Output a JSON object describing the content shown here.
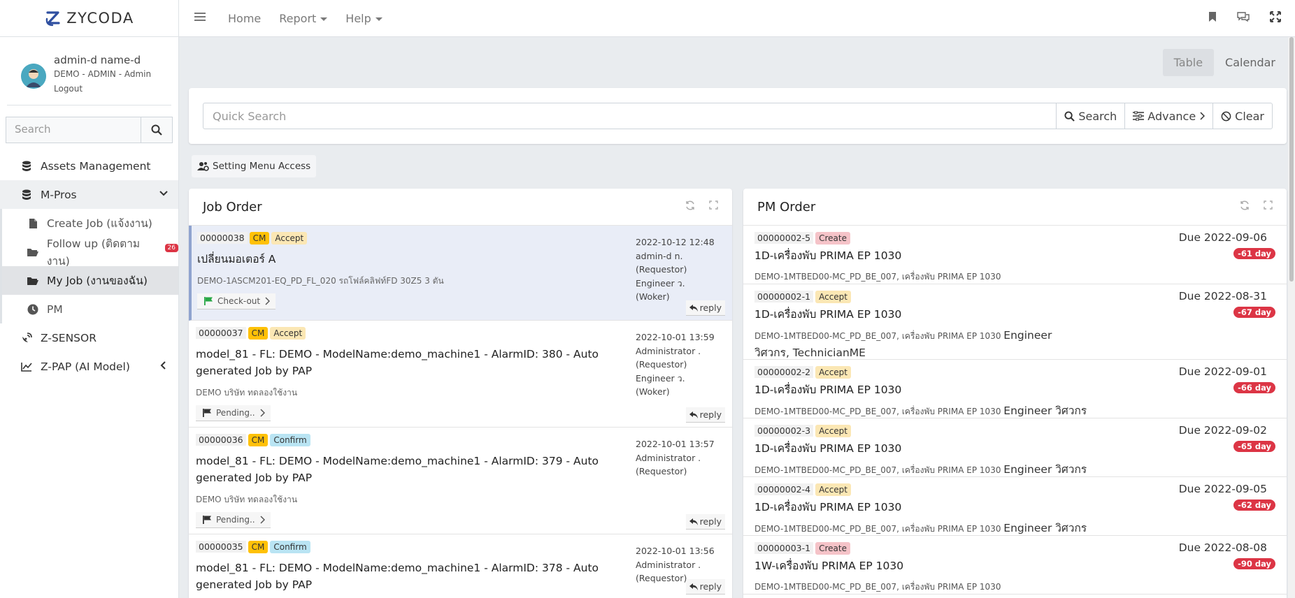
{
  "brand": {
    "name": "ZYCODA"
  },
  "user": {
    "name": "admin-d name-d",
    "role": "DEMO - ADMIN - Admin",
    "logout": "Logout"
  },
  "sidebar": {
    "search_placeholder": "Search",
    "items": [
      {
        "label": "Assets Management"
      },
      {
        "label": "M-Pros"
      },
      {
        "label": "Create Job (แจ้งงาน)"
      },
      {
        "label": "Follow up (ติดตามงาน)",
        "badge": "26"
      },
      {
        "label": "My Job (งานของฉัน)"
      },
      {
        "label": "PM"
      },
      {
        "label": "Z-SENSOR"
      },
      {
        "label": "Z-PAP (AI Model)"
      }
    ]
  },
  "topnav": {
    "home": "Home",
    "report": "Report",
    "help": "Help"
  },
  "view": {
    "table": "Table",
    "calendar": "Calendar"
  },
  "search": {
    "placeholder": "Quick Search",
    "search": "Search",
    "advance": "Advance",
    "clear": "Clear"
  },
  "setting_menu": "Setting Menu Access",
  "job_order": {
    "title": "Job Order",
    "rows": [
      {
        "code": "00000038",
        "type": "CM",
        "status": "Accept",
        "title": "เปลี่ยนมอเตอร์ A",
        "sub": "DEMO-1ASCM201-EQ_PD_FL_020 รถโฟล์คลิฟท์FD 30Z5 3 ตัน",
        "action": "Check-out",
        "date": "2022-10-12 12:48",
        "l1": "admin-d n.",
        "l2": "(Requestor)",
        "l3": "Engineer ว.",
        "l4": "(Woker)",
        "reply": "reply"
      },
      {
        "code": "00000037",
        "type": "CM",
        "status": "Accept",
        "title": "model_81 - FL: DEMO - ModelName:demo_machine1 - AlarmID: 380 - Auto generated Job by PAP",
        "sub": "DEMO บริษัท ทดลองใช้งาน",
        "action": "Pending..",
        "date": "2022-10-01 13:59",
        "l1": "Administrator .",
        "l2": "(Requestor)",
        "l3": "Engineer ว.",
        "l4": "(Woker)",
        "reply": "reply"
      },
      {
        "code": "00000036",
        "type": "CM",
        "status": "Confirm",
        "title": "model_81 - FL: DEMO - ModelName:demo_machine1 - AlarmID: 379 - Auto generated Job by PAP",
        "sub": "DEMO บริษัท ทดลองใช้งาน",
        "action": "Pending..",
        "date": "2022-10-01 13:57",
        "l1": "Administrator .",
        "l2": "(Requestor)",
        "l3": "",
        "l4": "",
        "reply": "reply"
      },
      {
        "code": "00000035",
        "type": "CM",
        "status": "Confirm",
        "title": "model_81 - FL: DEMO - ModelName:demo_machine1 - AlarmID: 378 - Auto generated Job by PAP",
        "sub": "",
        "action": "",
        "date": "2022-10-01 13:56",
        "l1": "Administrator .",
        "l2": "(Requestor)",
        "l3": "",
        "l4": "",
        "reply": "reply"
      }
    ]
  },
  "pm_order": {
    "title": "PM Order",
    "rows": [
      {
        "code": "00000002-5",
        "status": "Create",
        "title": "1D-เครื่องพับ PRIMA EP 1030",
        "sub": "DEMO-1MTBED00-MC_PD_BE_007, เครื่องพับ PRIMA EP 1030",
        "eng": "",
        "due": "Due 2022-09-06",
        "days": "-61 day"
      },
      {
        "code": "00000002-1",
        "status": "Accept",
        "title": "1D-เครื่องพับ PRIMA EP 1030",
        "sub": "DEMO-1MTBED00-MC_PD_BE_007, เครื่องพับ PRIMA EP 1030",
        "eng": "Engineer วิศวกร, TechnicianME",
        "due": "Due 2022-08-31",
        "days": "-67 day"
      },
      {
        "code": "00000002-2",
        "status": "Accept",
        "title": "1D-เครื่องพับ PRIMA EP 1030",
        "sub": "DEMO-1MTBED00-MC_PD_BE_007, เครื่องพับ PRIMA EP 1030",
        "eng": "Engineer วิศวกร",
        "due": "Due 2022-09-01",
        "days": "-66 day"
      },
      {
        "code": "00000002-3",
        "status": "Accept",
        "title": "1D-เครื่องพับ PRIMA EP 1030",
        "sub": "DEMO-1MTBED00-MC_PD_BE_007, เครื่องพับ PRIMA EP 1030",
        "eng": "Engineer วิศวกร",
        "due": "Due 2022-09-02",
        "days": "-65 day"
      },
      {
        "code": "00000002-4",
        "status": "Accept",
        "title": "1D-เครื่องพับ PRIMA EP 1030",
        "sub": "DEMO-1MTBED00-MC_PD_BE_007, เครื่องพับ PRIMA EP 1030",
        "eng": "Engineer วิศวกร",
        "due": "Due 2022-09-05",
        "days": "-62 day"
      },
      {
        "code": "00000003-1",
        "status": "Create",
        "title": "1W-เครื่องพับ PRIMA EP 1030",
        "sub": "DEMO-1MTBED00-MC_PD_BE_007, เครื่องพับ PRIMA EP 1030",
        "eng": "",
        "due": "Due 2022-08-08",
        "days": "-90 day"
      }
    ]
  },
  "colors": {
    "accent": "#dc3545",
    "sidebar_active": "#e1e3e6",
    "selected_row": "#e9edf7"
  }
}
